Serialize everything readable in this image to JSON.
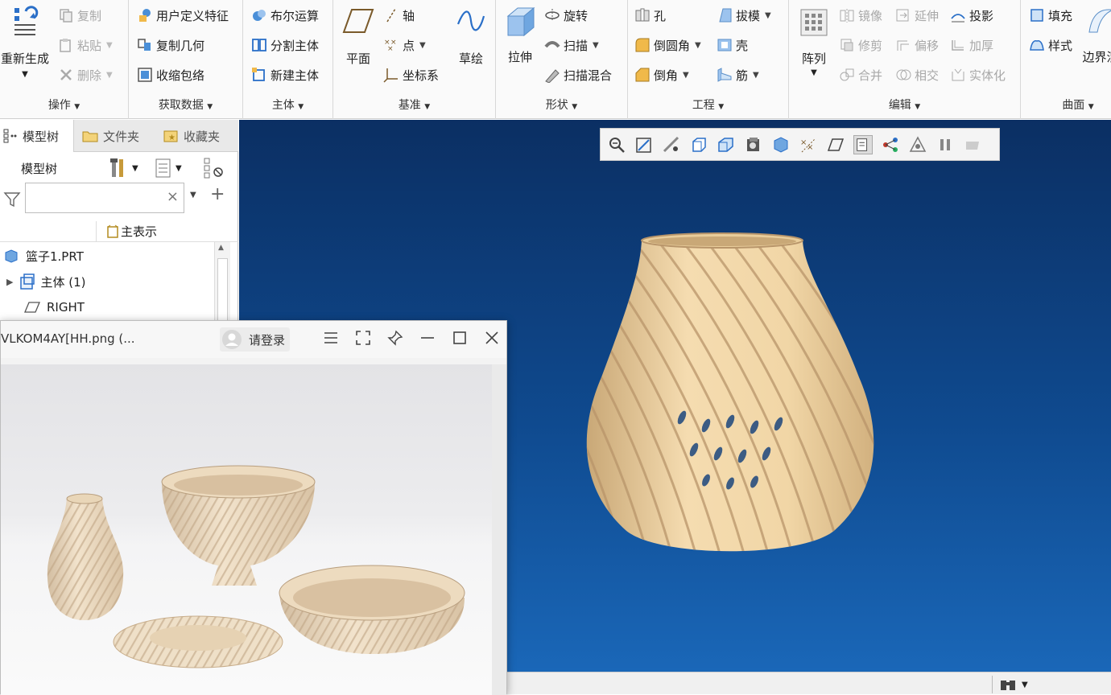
{
  "ribbon": {
    "ops": {
      "regen": "重新生成",
      "copy": "复制",
      "paste": "粘贴",
      "delete": "删除",
      "label": "操作"
    },
    "get_data": {
      "udf": "用户定义特征",
      "copy_geom": "复制几何",
      "shrinkwrap": "收缩包络",
      "label": "获取数据"
    },
    "body": {
      "boolean": "布尔运算",
      "split": "分割主体",
      "new": "新建主体",
      "label": "主体"
    },
    "datum": {
      "plane": "平面",
      "axis": "轴",
      "point": "点",
      "csys": "坐标系",
      "sketch": "草绘",
      "label": "基准"
    },
    "shapes": {
      "extrude": "拉伸",
      "revolve": "旋转",
      "sweep": "扫描",
      "swept_blend": "扫描混合",
      "label": "形状"
    },
    "engineering": {
      "hole": "孔",
      "round": "倒圆角",
      "chamfer": "倒角",
      "draft": "拔模",
      "shell": "壳",
      "rib": "筋",
      "label": "工程"
    },
    "editing": {
      "pattern": "阵列",
      "mirror": "镜像",
      "extend": "延伸",
      "project": "投影",
      "trim": "修剪",
      "offset": "偏移",
      "thicken": "加厚",
      "merge": "合并",
      "intersect": "相交",
      "solidify": "实体化",
      "label": "编辑"
    },
    "surfaces": {
      "fill": "填充",
      "style": "样式",
      "boundary": "边界混",
      "label": "曲面"
    }
  },
  "left_panel": {
    "tabs": [
      "模型树",
      "文件夹",
      "收藏夹"
    ],
    "header": "模型树",
    "filter": {
      "value": "",
      "clear": "×"
    },
    "column_header": "主表示",
    "tree": [
      {
        "label": "篮子1.PRT"
      },
      {
        "label": "主体 (1)"
      },
      {
        "label": "RIGHT"
      }
    ]
  },
  "viewer": {
    "title": "VLKOM4AY[HH.png (...",
    "login": "请登录"
  },
  "colors": {
    "viewport_top": "#0b2f63",
    "viewport_bottom": "#1a67b8",
    "vase": "#f1d6a6",
    "accent": "#1f6fc5"
  }
}
